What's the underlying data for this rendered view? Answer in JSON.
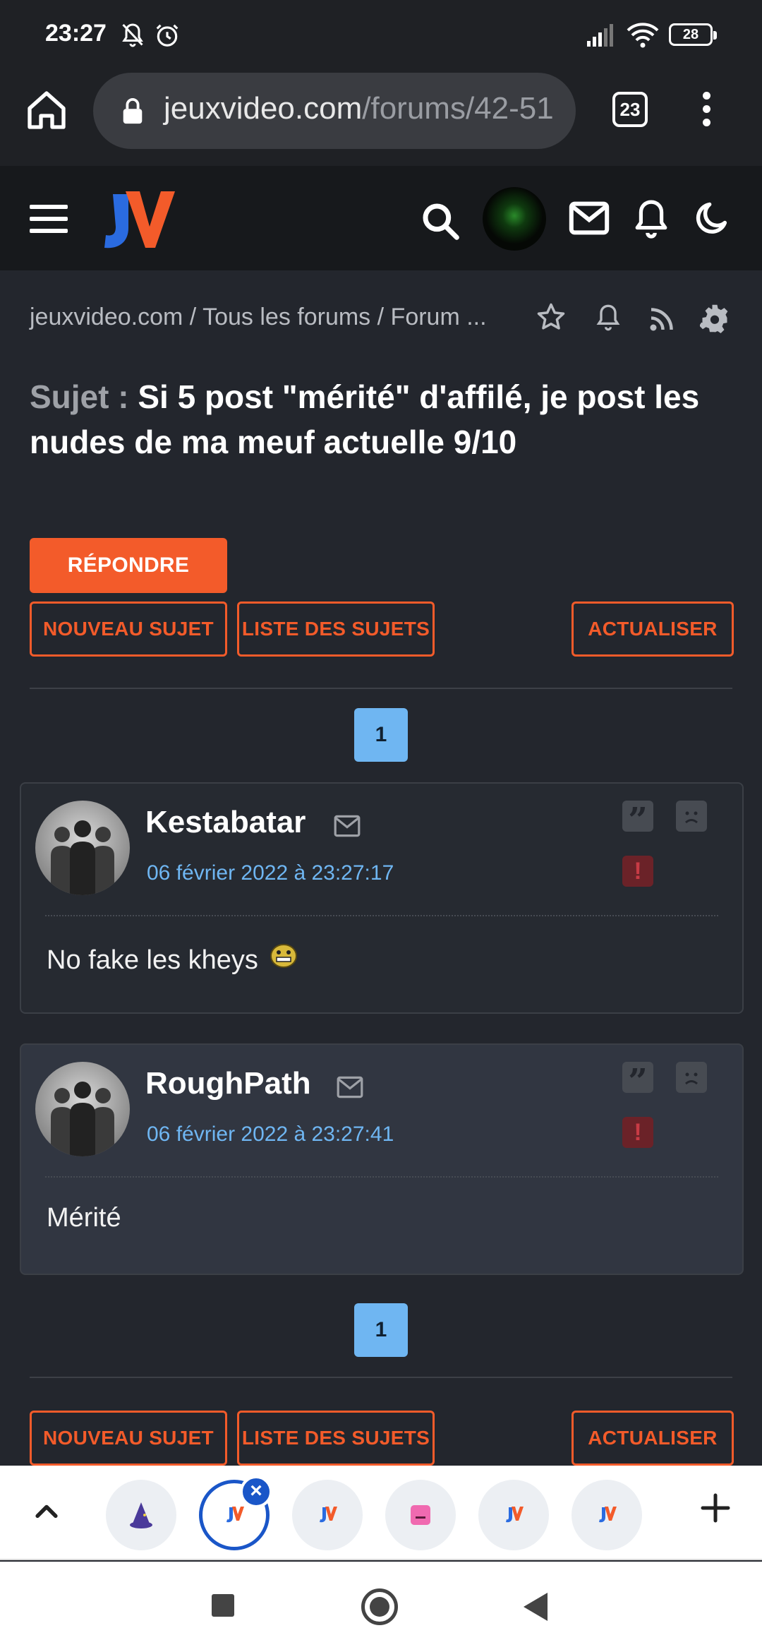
{
  "status_bar": {
    "time": "23:27",
    "battery": "28"
  },
  "browser": {
    "url_domain": "jeuxvideo.com",
    "url_path": "/forums/42-51",
    "tab_count": "23"
  },
  "breadcrumb": {
    "items": [
      "jeuxvideo.com",
      "/",
      "Tous les forums",
      "/",
      "Forum ..."
    ]
  },
  "topic": {
    "prefix": "Sujet :",
    "title": "Si 5 post \"mérité\" d'affilé, je post les nudes de ma meuf actuelle 9/10"
  },
  "buttons": {
    "reply": "RÉPONDRE",
    "new_topic": "NOUVEAU SUJET",
    "topic_list": "LISTE DES SUJETS",
    "refresh": "ACTUALISER"
  },
  "pagination": {
    "current_page": "1"
  },
  "posts": [
    {
      "author": "Kestabatar",
      "date": "06 février 2022 à 23:27:17",
      "body": "No fake les kheys"
    },
    {
      "author": "RoughPath",
      "date": "06 février 2022 à 23:27:41",
      "body": "Mérité"
    }
  ],
  "icons": {
    "status": [
      "bell-off-icon",
      "alarm-icon",
      "signal-icon",
      "wifi-icon",
      "battery-icon"
    ],
    "breadcrumb_actions": [
      "star-icon",
      "bell-icon",
      "rss-icon",
      "gear-icon"
    ],
    "post_actions": [
      "quote-icon",
      "sad-face-icon",
      "report-icon"
    ]
  },
  "colors": {
    "accent": "#f35b2a",
    "link_blue": "#6fb6f2",
    "background": "#23262d",
    "header": "#17191c",
    "tab_active": "#1a56c8"
  }
}
